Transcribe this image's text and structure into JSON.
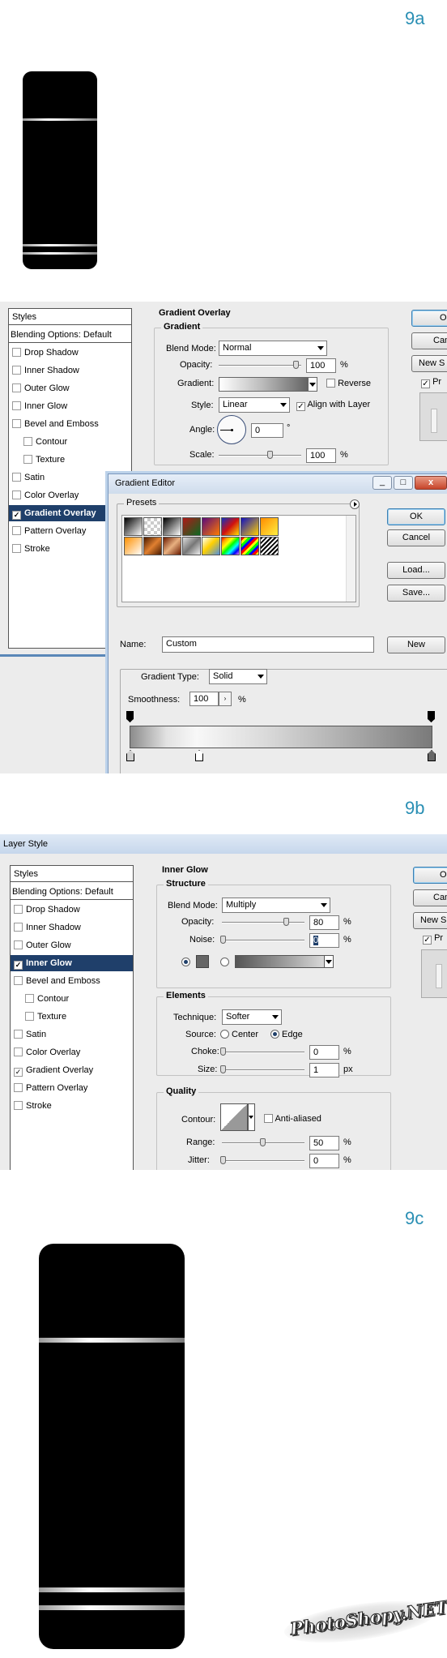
{
  "steps": {
    "a": "9a",
    "b": "9b",
    "c": "9c"
  },
  "dialog_title": "Layer Style",
  "styles_list": {
    "header": "Styles",
    "blending": "Blending Options: Default",
    "items": [
      {
        "label": "Drop Shadow",
        "checked": false,
        "indent": false
      },
      {
        "label": "Inner Shadow",
        "checked": false,
        "indent": false
      },
      {
        "label": "Outer Glow",
        "checked": false,
        "indent": false
      },
      {
        "label": "Inner Glow",
        "checked": false,
        "indent": false
      },
      {
        "label": "Bevel and Emboss",
        "checked": false,
        "indent": false
      },
      {
        "label": "Contour",
        "checked": false,
        "indent": true
      },
      {
        "label": "Texture",
        "checked": false,
        "indent": true
      },
      {
        "label": "Satin",
        "checked": false,
        "indent": false
      },
      {
        "label": "Color Overlay",
        "checked": false,
        "indent": false
      },
      {
        "label": "Gradient Overlay",
        "checked": true,
        "indent": false
      },
      {
        "label": "Pattern Overlay",
        "checked": false,
        "indent": false
      },
      {
        "label": "Stroke",
        "checked": false,
        "indent": false
      }
    ]
  },
  "gradient_overlay": {
    "title": "Gradient Overlay",
    "group": "Gradient",
    "blend_mode_label": "Blend Mode:",
    "blend_mode": "Normal",
    "opacity_label": "Opacity:",
    "opacity": "100",
    "pct": "%",
    "gradient_label": "Gradient:",
    "reverse": "Reverse",
    "style_label": "Style:",
    "style": "Linear",
    "align": "Align with Layer",
    "angle_label": "Angle:",
    "angle": "0",
    "deg": "°",
    "scale_label": "Scale:",
    "scale": "100"
  },
  "right_buttons": {
    "ok_partial": "O",
    "cancel_partial": "Can",
    "new_partial": "New S",
    "preview_partial": "Pr"
  },
  "gradient_editor": {
    "title": "Gradient Editor",
    "presets": "Presets",
    "ok": "OK",
    "cancel": "Cancel",
    "load": "Load...",
    "save": "Save...",
    "name_label": "Name:",
    "name": "Custom",
    "new": "New",
    "type_label": "Gradient Type:",
    "type": "Solid",
    "smooth_label": "Smoothness:",
    "smooth": "100",
    "pct": "%"
  },
  "inner_glow": {
    "title": "Inner Glow",
    "structure": "Structure",
    "blend_mode_label": "Blend Mode:",
    "blend_mode": "Multiply",
    "opacity_label": "Opacity:",
    "opacity": "80",
    "noise_label": "Noise:",
    "noise": "0",
    "pct": "%",
    "elements": "Elements",
    "technique_label": "Technique:",
    "technique": "Softer",
    "source_label": "Source:",
    "center": "Center",
    "edge": "Edge",
    "choke_label": "Choke:",
    "choke": "0",
    "size_label": "Size:",
    "size": "1",
    "px": "px",
    "quality": "Quality",
    "contour_label": "Contour:",
    "antialiased": "Anti-aliased",
    "range_label": "Range:",
    "range": "50",
    "jitter_label": "Jitter:",
    "jitter": "0"
  },
  "watermark": "PhotoShopy.NET",
  "colors": {
    "accent": "#2a8fb4",
    "selection": "#1f3f6a"
  }
}
